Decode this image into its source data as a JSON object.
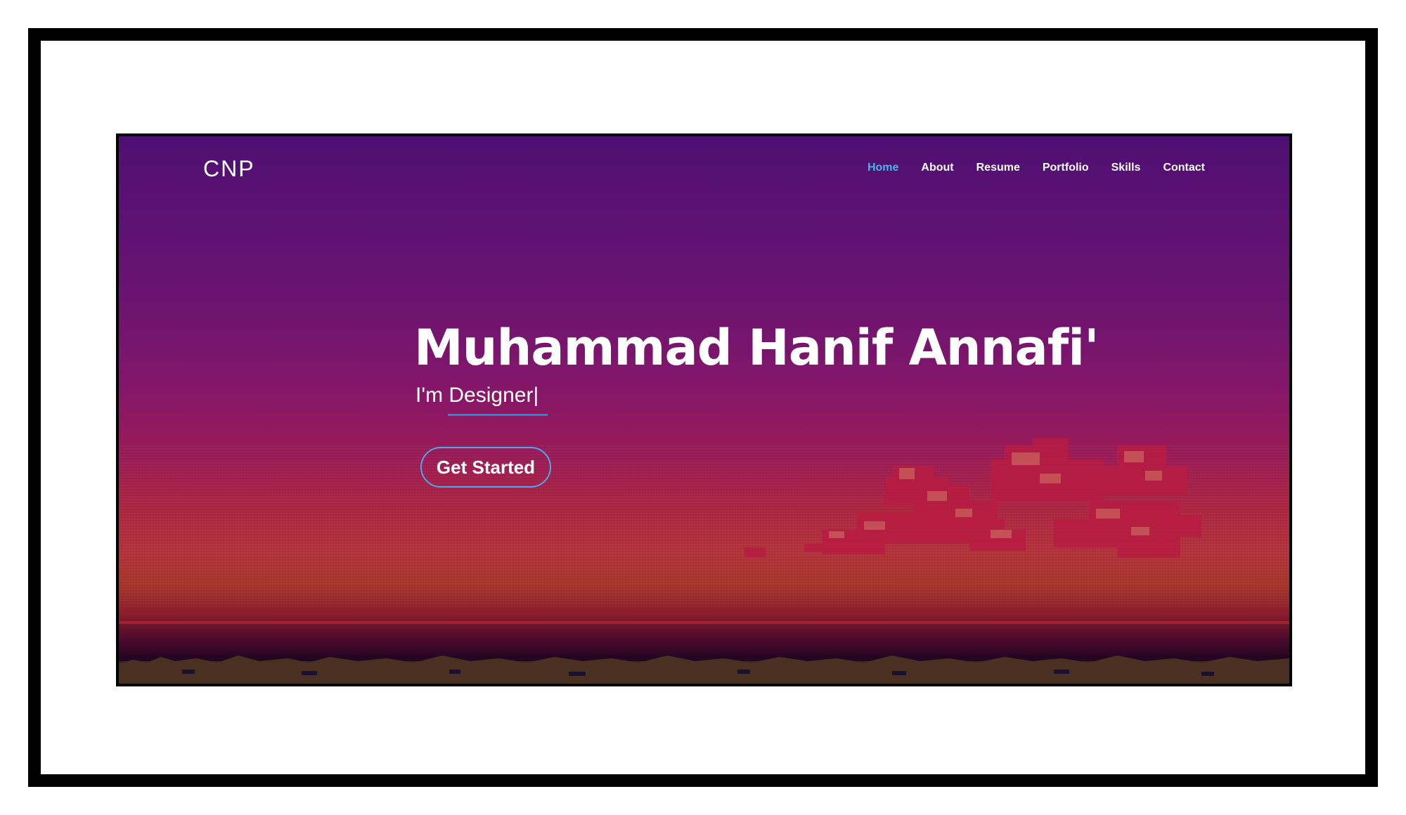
{
  "brand": {
    "logo": "CNP"
  },
  "nav": {
    "items": [
      {
        "label": "Home",
        "active": true
      },
      {
        "label": "About",
        "active": false
      },
      {
        "label": "Resume",
        "active": false
      },
      {
        "label": "Portfolio",
        "active": false
      },
      {
        "label": "Skills",
        "active": false
      },
      {
        "label": "Contact",
        "active": false
      }
    ]
  },
  "hero": {
    "name": "Muhammad Hanif Annafi'",
    "role_text": "I'm Designer|",
    "cta_label": "Get Started"
  },
  "colors": {
    "accent": "#4db3e8",
    "underline": "#1a8fd8",
    "gradient_top": "#4e0f72",
    "gradient_mid": "#9a1a58",
    "gradient_low": "#ae2440",
    "cloud": "#b81c42",
    "cloud_highlight": "#c75a5a"
  }
}
